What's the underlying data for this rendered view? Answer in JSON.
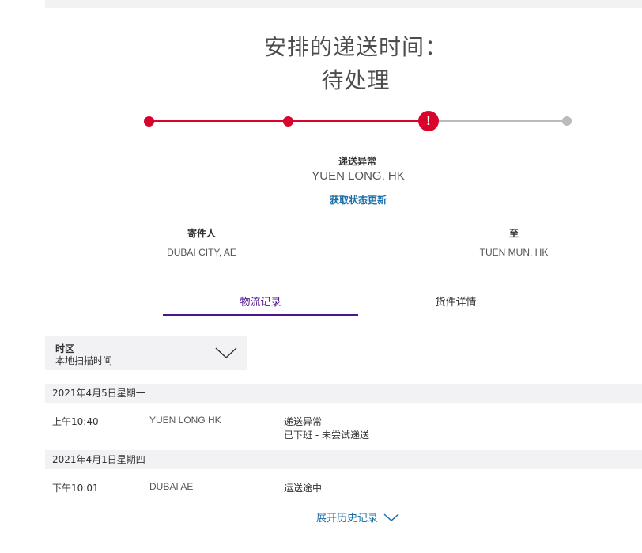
{
  "header": {
    "title_line1": "安排的递送时间：",
    "title_line2": "待处理"
  },
  "status": {
    "label": "递送异常",
    "location": "YUEN LONG, HK",
    "update_link": "获取状态更新",
    "active_color": "#d9042b",
    "inactive_color": "#bbbbbb",
    "steps": [
      {
        "state": "done"
      },
      {
        "state": "done"
      },
      {
        "state": "exception",
        "icon": "!"
      },
      {
        "state": "pending"
      }
    ]
  },
  "shipment": {
    "from_label": "寄件人",
    "from_value": "DUBAI CITY, AE",
    "to_label": "至",
    "to_value": "TUEN MUN, HK"
  },
  "tabs": [
    {
      "label": "物流记录",
      "active": true
    },
    {
      "label": "货件详情",
      "active": false
    }
  ],
  "timezone": {
    "label": "时区",
    "value": "本地扫描时间"
  },
  "history": [
    {
      "date": "2021年4月5日星期一",
      "events": [
        {
          "time": "上午10:40",
          "location": "YUEN LONG HK",
          "description": "递送异常",
          "detail": "已下班 - 未尝试递送"
        }
      ]
    },
    {
      "date": "2021年4月1日星期四",
      "events": [
        {
          "time": "下午10:01",
          "location": "DUBAI AE",
          "description": "运送途中",
          "detail": ""
        }
      ]
    }
  ],
  "expand_link": "展开历史记录",
  "colors": {
    "accent_purple": "#4d148c",
    "link_blue": "#1a6fa8",
    "alert_red": "#d9042b"
  }
}
